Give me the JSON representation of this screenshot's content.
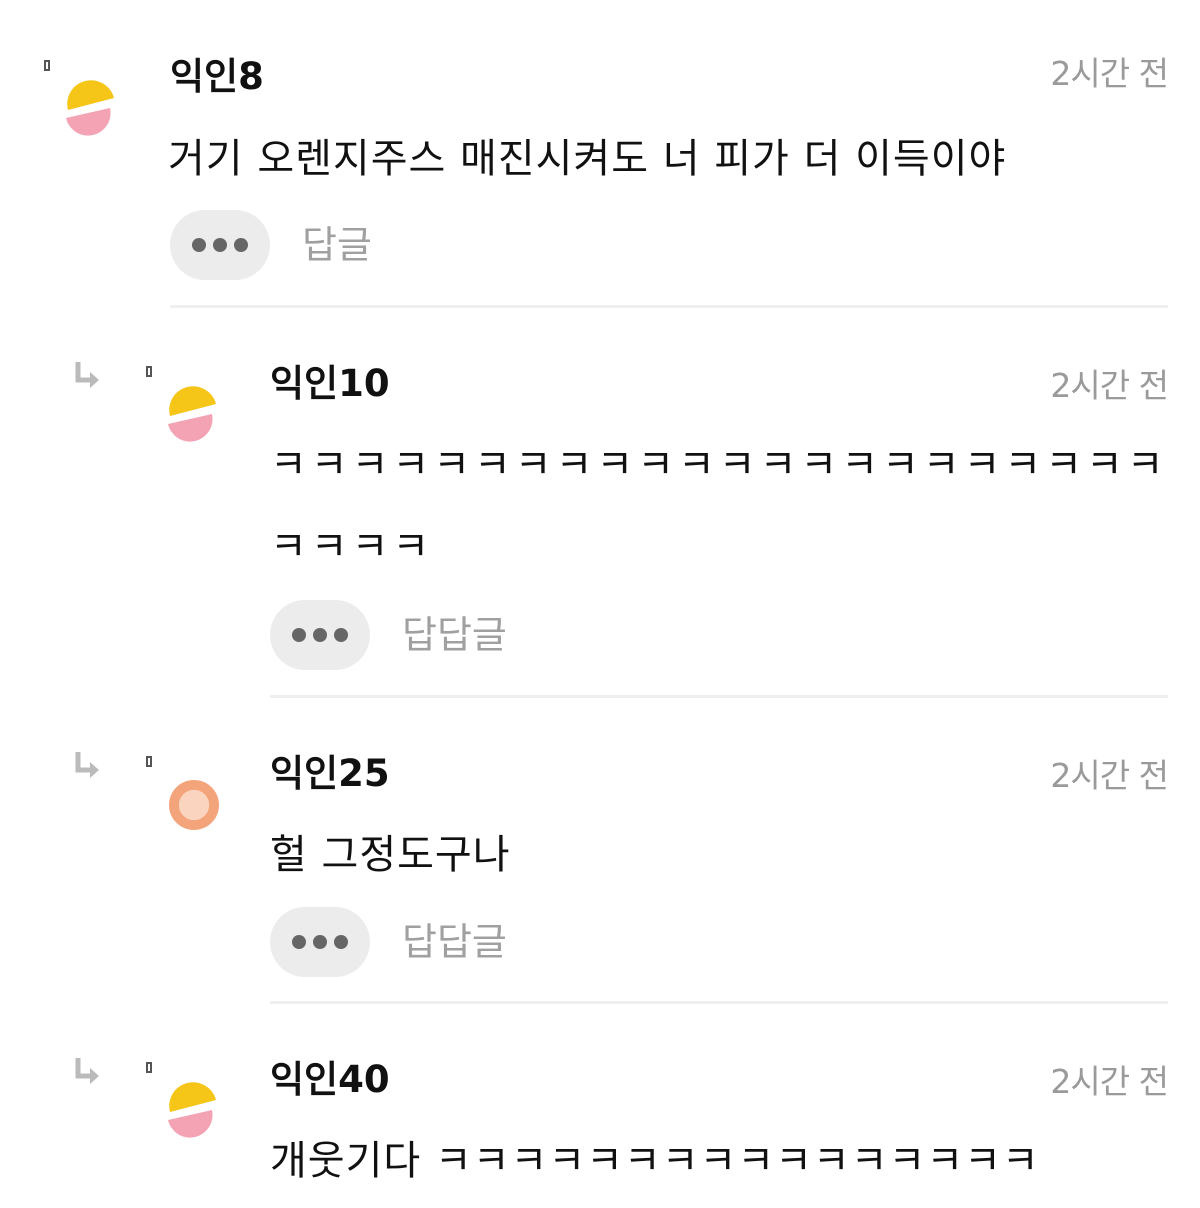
{
  "comments": [
    {
      "username": "익인8",
      "time": "2시간 전",
      "text": "거기 오렌지주스 매진시켜도 너 피가 더 이득이야",
      "reply_label": "답글",
      "avatar_icon": "yellow-pink-halves-avatar-icon",
      "is_reply": false
    },
    {
      "username": "익인10",
      "time": "2시간 전",
      "text": "ㅋㅋㅋㅋㅋㅋㅋㅋㅋㅋㅋㅋㅋㅋㅋㅋㅋㅋㅋㅋㅋㅋㅋㅋㅋㅋ",
      "reply_label": "답답글",
      "avatar_icon": "yellow-pink-halves-avatar-icon",
      "is_reply": true
    },
    {
      "username": "익인25",
      "time": "2시간 전",
      "text": "헐 그정도구나",
      "reply_label": "답답글",
      "avatar_icon": "orange-ring-avatar-icon",
      "is_reply": true
    },
    {
      "username": "익인40",
      "time": "2시간 전",
      "text": "개웃기다 ㅋㅋㅋㅋㅋㅋㅋㅋㅋㅋㅋㅋㅋㅋㅋㅋ",
      "reply_label": "",
      "avatar_icon": "yellow-pink-halves-avatar-icon",
      "is_reply": true
    }
  ],
  "colors": {
    "avatar_yellow": "#f5c518",
    "avatar_pink": "#f4a3b5",
    "avatar_orange": "#f4a47a",
    "time_gray": "#9a9a9a",
    "button_bg": "#ececec"
  }
}
